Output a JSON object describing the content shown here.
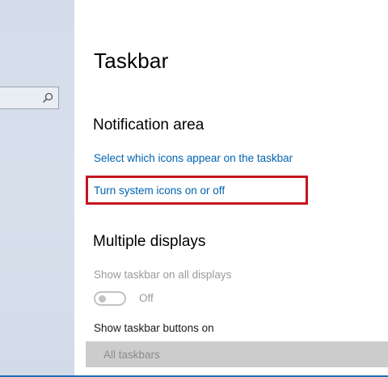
{
  "page": {
    "title": "Taskbar"
  },
  "notification_area": {
    "title": "Notification area",
    "links": [
      "Select which icons appear on the taskbar",
      "Turn system icons on or off"
    ]
  },
  "multiple_displays": {
    "title": "Multiple displays",
    "show_all_label": "Show taskbar on all displays",
    "show_all_toggle": {
      "state_label": "Off",
      "on": false,
      "enabled": false
    },
    "buttons_label": "Show taskbar buttons on",
    "buttons_dropdown": {
      "selected": "All taskbars",
      "enabled": false
    }
  },
  "icons": {
    "search": "search-icon"
  },
  "colors": {
    "link": "#0063b1",
    "highlight": "#c4141f",
    "nav_pane": "#d6dfeb",
    "disabled_text": "#9a9a9a"
  }
}
